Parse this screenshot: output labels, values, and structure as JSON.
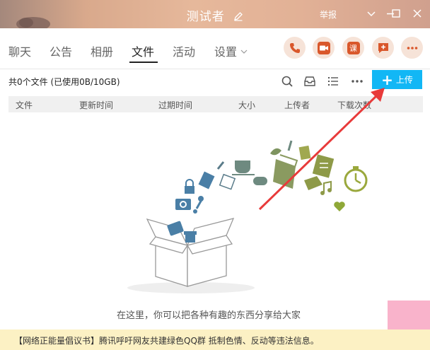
{
  "window": {
    "title": "测试者",
    "report_label": "举报"
  },
  "tabs": [
    {
      "label": "聊天"
    },
    {
      "label": "公告"
    },
    {
      "label": "相册"
    },
    {
      "label": "文件"
    },
    {
      "label": "活动"
    },
    {
      "label": "设置"
    }
  ],
  "actions": {
    "course_label": "课"
  },
  "files": {
    "count_text": "共0个文件 (已使用0B/10GB)",
    "upload_label": "上传",
    "columns": [
      "文件",
      "更新时间",
      "过期时间",
      "大小",
      "上传者",
      "下载次数"
    ],
    "empty_tip": "在这里，你可以把各种有趣的东西分享给大家"
  },
  "notice": {
    "text": "【网络正能量倡议书】腾讯呼吁网友共建绿色QQ群 抵制色情、反动等违法信息。"
  },
  "colors": {
    "accent": "#12b7f5",
    "action_icon": "#d9572b",
    "annotation_arrow": "#e83a3a"
  }
}
